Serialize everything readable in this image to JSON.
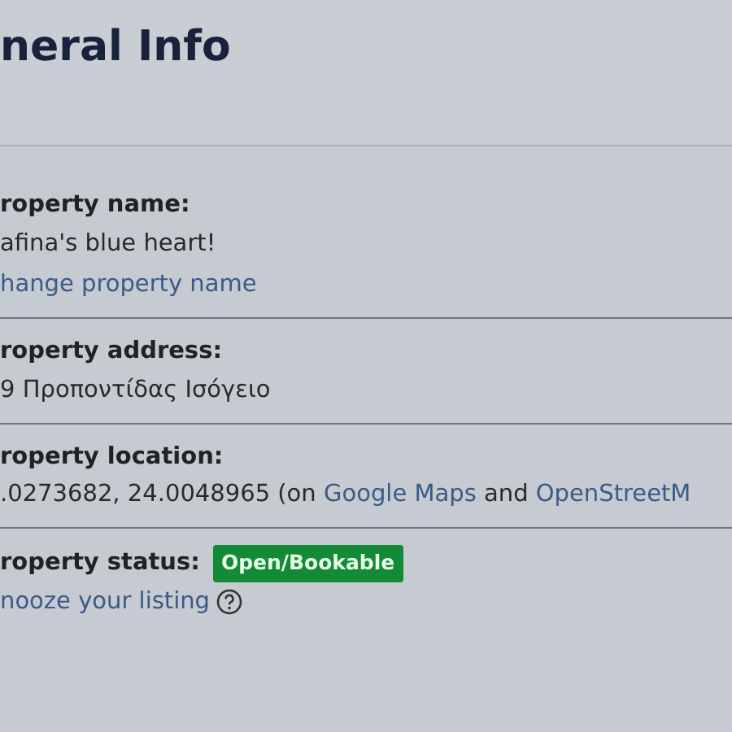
{
  "heading": "neral Info",
  "items": [
    {
      "kind": "name",
      "label": "roperty name:",
      "value": "afina's blue heart!",
      "link": "hange property name"
    },
    {
      "kind": "address",
      "label": "roperty address:",
      "value": "9 Προποντίδας Ισόγειο"
    },
    {
      "kind": "location",
      "label": "roperty location:",
      "parts": [
        {
          "kind": "text",
          "text": ".0273682, 24.0048965 (on "
        },
        {
          "kind": "link",
          "text": "Google Maps"
        },
        {
          "kind": "text",
          "text": " and "
        },
        {
          "kind": "link",
          "text": "OpenStreetM"
        }
      ]
    },
    {
      "kind": "status",
      "label": "roperty status:",
      "badge": "Open/Bookable",
      "link": "nooze your listing"
    }
  ]
}
